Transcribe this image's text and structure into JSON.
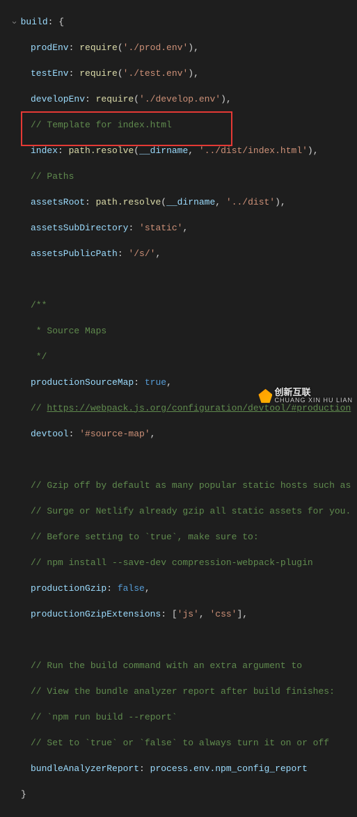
{
  "code": {
    "build_key": "build",
    "brace_open": "{",
    "brace_close": "}",
    "folding_caret": "›",
    "prodEnv_key": "prodEnv",
    "require_fn": "require",
    "prodEnv_path": "'./prod.env'",
    "testEnv_key": "testEnv",
    "testEnv_path": "'./test.env'",
    "developEnv_key": "developEnv",
    "developEnv_path": "'./develop.env'",
    "template_comment": "// Template for index.html",
    "index_key": "index",
    "path_resolve": "path.resolve",
    "dirname": "__dirname",
    "index_path": "'../dist/index.html'",
    "paths_comment": "// Paths",
    "assetsRoot_key": "assetsRoot",
    "assetsRoot_path": "'../dist'",
    "assetsSubDirectory_key": "assetsSubDirectory",
    "assetsSubDirectory_val": "'static'",
    "assetsPublicPath_key": "assetsPublicPath",
    "assetsPublicPath_val": "'/s/'",
    "sourcemaps_comment_1": "/**",
    "sourcemaps_comment_2": " * Source Maps",
    "sourcemaps_comment_3": " */",
    "productionSourceMap_key": "productionSourceMap",
    "true_val": "true",
    "devtool_url_comment": "// ",
    "devtool_url": "https://webpack.js.org/configuration/devtool/#production",
    "devtool_key": "devtool",
    "devtool_val": "'#source-map'",
    "gzip_comment_1": "// Gzip off by default as many popular static hosts such as",
    "gzip_comment_2": "// Surge or Netlify already gzip all static assets for you.",
    "gzip_comment_3": "// Before setting to `true`, make sure to:",
    "gzip_comment_4": "// npm install --save-dev compression-webpack-plugin",
    "productionGzip_key": "productionGzip",
    "false_val": "false",
    "productionGzipExtensions_key": "productionGzipExtensions",
    "gzip_ext_js": "'js'",
    "gzip_ext_css": "'css'",
    "analyzer_comment_1": "// Run the build command with an extra argument to",
    "analyzer_comment_2": "// View the bundle analyzer report after build finishes:",
    "analyzer_comment_3": "// `npm run build --report`",
    "analyzer_comment_4": "// Set to `true` or `false` to always turn it on or off",
    "bundleAnalyzerReport_key": "bundleAnalyzerReport",
    "bundleAnalyzerReport_val": "process.env.npm_config_report"
  },
  "watermark": {
    "main": "创新互联",
    "sub": "CHUANG XIN HU LIAN"
  }
}
